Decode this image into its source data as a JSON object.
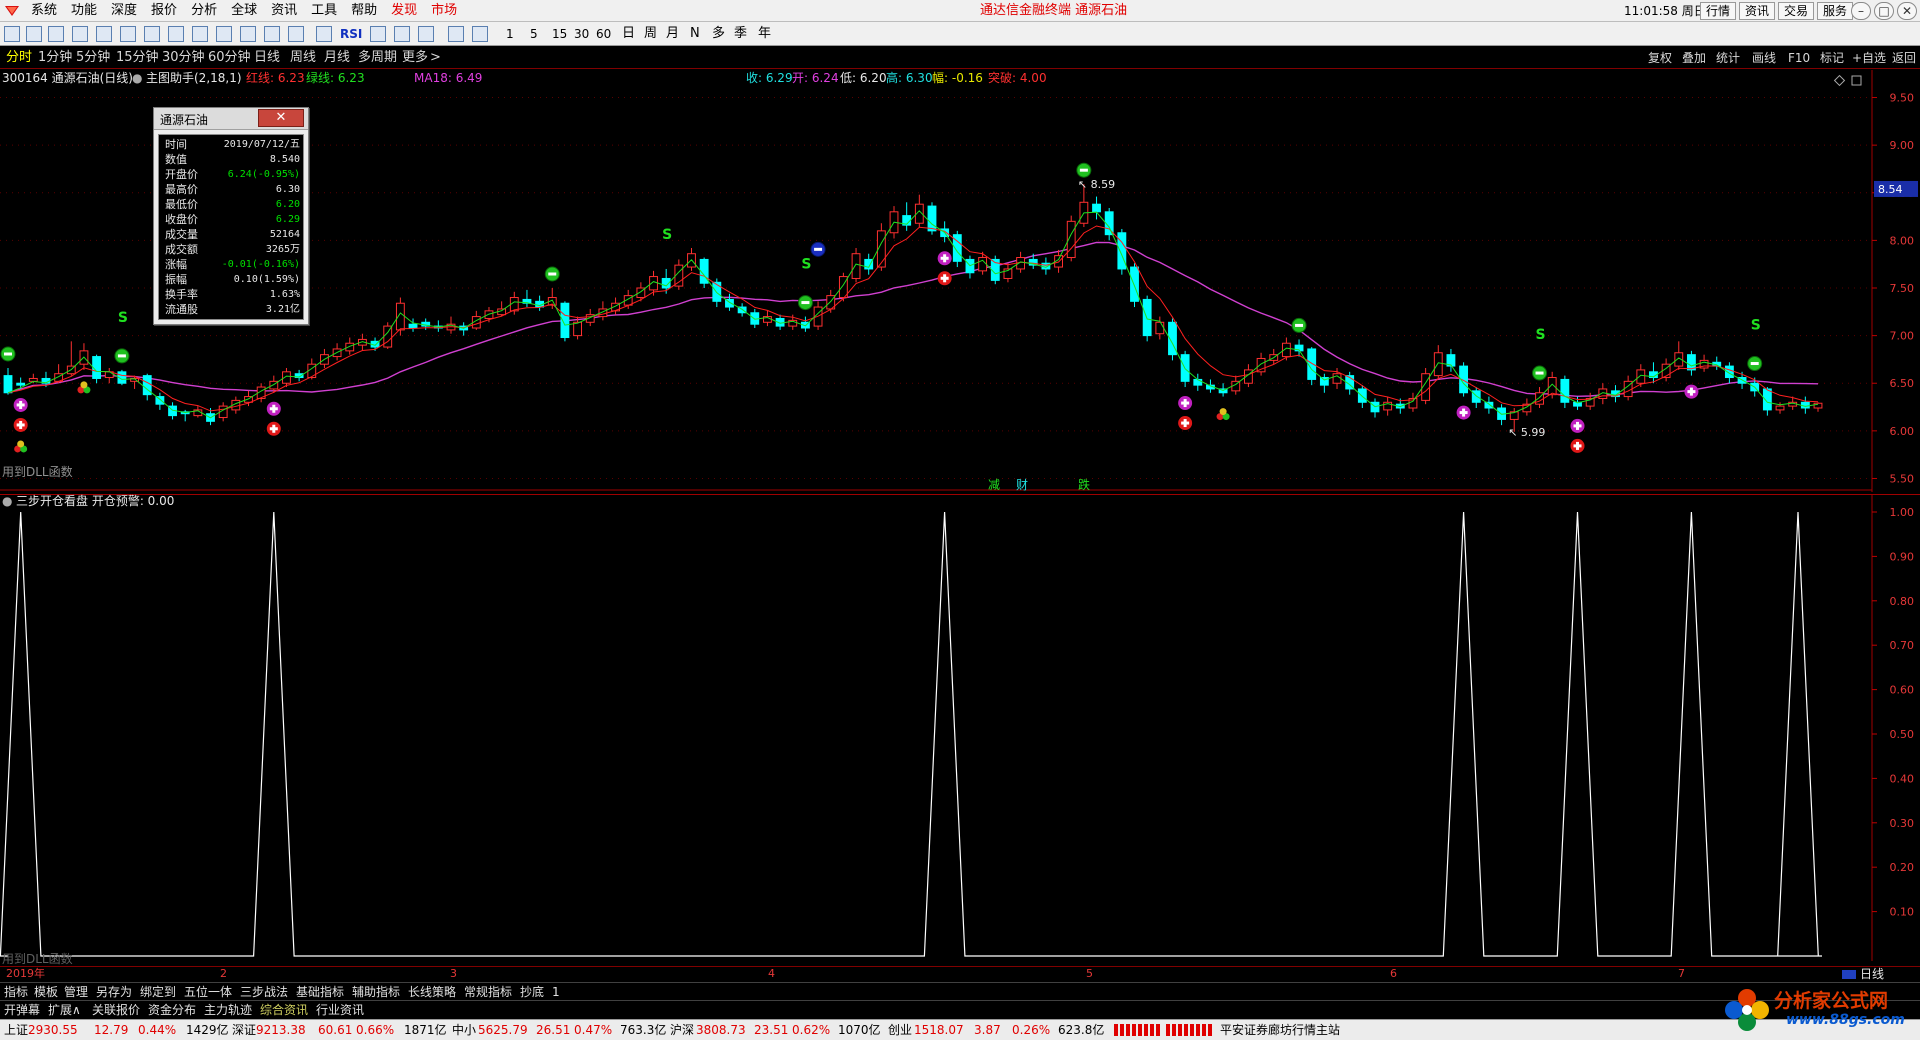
{
  "menubar": {
    "menus": [
      "系统",
      "功能",
      "深度",
      "报价",
      "分析",
      "全球",
      "资讯",
      "工具",
      "帮助"
    ],
    "hot_menus": [
      "发现",
      "市场"
    ],
    "title": "通达信金融终端 通源石油",
    "clock": "11:01:58 周日",
    "right_buttons": [
      "行情",
      "资讯",
      "交易",
      "服务"
    ]
  },
  "toolbar": {
    "rsi_label": "RSI",
    "periods": [
      "1",
      "5",
      "15",
      "30",
      "60"
    ],
    "periods_cn": [
      "日",
      "周",
      "月",
      "N",
      "多",
      "季",
      "年"
    ]
  },
  "periodbar": {
    "items": [
      "分时",
      "1分钟",
      "5分钟",
      "15分钟",
      "30分钟",
      "60分钟",
      "日线",
      "周线",
      "月线",
      "多周期",
      "更多"
    ],
    "active": "分时",
    "right_items": [
      "复权",
      "叠加",
      "统计",
      "画线",
      "F10",
      "标记",
      "+自选",
      "返回"
    ]
  },
  "mainInfo": {
    "code": "300164 通源石油(日线)",
    "assistant": "主图助手(2,18,1)",
    "red_line": "红线: 6.23",
    "green_line": "绿线: 6.23",
    "ma": "MA18: 6.49",
    "close": "收: 6.29",
    "open": "开: 6.24",
    "low": "低: 6.20",
    "high": "高: 6.30",
    "amp": "幅: -0.16",
    "breakout": "突破: 4.00",
    "dll_note": "用到DLL函数",
    "flags": [
      "减",
      "财",
      "跌"
    ]
  },
  "subInfo": {
    "title": "三步开仓看盘 开仓预警: 0.00",
    "dll_note": "用到DLL函数"
  },
  "popup": {
    "title": "通源石油",
    "close": "✕",
    "rows": [
      {
        "k": "时间",
        "v": "2019/07/12/五",
        "c": "#e8e8e8"
      },
      {
        "k": "数值",
        "v": "8.540",
        "c": "#e8e8e8"
      },
      {
        "k": "开盘价",
        "v": "6.24(-0.95%)",
        "c": "#00e000"
      },
      {
        "k": "最高价",
        "v": "6.30",
        "c": "#e8e8e8"
      },
      {
        "k": "最低价",
        "v": "6.20",
        "c": "#00e000"
      },
      {
        "k": "收盘价",
        "v": "6.29",
        "c": "#00e000"
      },
      {
        "k": "成交量",
        "v": "52164",
        "c": "#e8e8e8"
      },
      {
        "k": "成交额",
        "v": "3265万",
        "c": "#e8e8e8"
      },
      {
        "k": "涨幅",
        "v": "-0.01(-0.16%)",
        "c": "#00e000"
      },
      {
        "k": "振幅",
        "v": "0.10(1.59%)",
        "c": "#e8e8e8"
      },
      {
        "k": "换手率",
        "v": "1.63%",
        "c": "#e8e8e8"
      },
      {
        "k": "流通股",
        "v": "3.21亿",
        "c": "#e8e8e8"
      }
    ]
  },
  "timeaxis": {
    "year": "2019年",
    "months": [
      "2",
      "3",
      "4",
      "5",
      "6",
      "7"
    ],
    "right": "日线"
  },
  "tabs1": [
    "指标",
    "模板",
    "管理",
    "另存为",
    "绑定到",
    "五位一体",
    "三步战法",
    "基础指标",
    "辅助指标",
    "长线策略",
    "常规指标",
    "抄底",
    "1"
  ],
  "tabs2": [
    "开弹幕",
    "扩展∧",
    "关联报价",
    "资金分布",
    "主力轨迹",
    "综合资讯",
    "行业资讯"
  ],
  "tabs2_active": "综合资讯",
  "statusbar": {
    "items": [
      {
        "label": "上证",
        "value": "2930.55",
        "chg": "12.79",
        "pct": "0.44%",
        "amt": "1429亿"
      },
      {
        "label": "深证",
        "value": "9213.38",
        "chg": "60.61",
        "pct": "0.66%",
        "amt": "1871亿"
      },
      {
        "label": "中小",
        "value": "5625.79",
        "chg": "26.51",
        "pct": "0.47%",
        "amt": "763.3亿"
      },
      {
        "label": "沪深",
        "value": "3808.73",
        "chg": "23.51",
        "pct": "0.62%",
        "amt": "1070亿"
      },
      {
        "label": "创业",
        "value": "1518.07",
        "chg": "3.87",
        "pct": "0.26%",
        "amt": "623.8亿"
      }
    ],
    "broker": "平安证券廊坊行情主站"
  },
  "watermark": {
    "title": "分析家公式网",
    "url": "www.88gs.com"
  },
  "chart_data": {
    "type": "candlestick",
    "title": "300164 通源石油(日线)",
    "ylim": [
      5.4,
      9.6
    ],
    "y_ticks": [
      "9.50",
      "9.00",
      "8.50",
      "8.00",
      "7.50",
      "7.00",
      "6.50",
      "6.00",
      "5.50"
    ],
    "current_price_label": "8.54",
    "colors": {
      "up": "#ff3030",
      "down": "#00ffff",
      "ma18": "#d040d0",
      "red_line": "#ff2020",
      "green_line": "#20e020"
    },
    "annotations": [
      "8.59",
      "5.99"
    ],
    "candles": [
      [
        6.58,
        6.4,
        6.66,
        6.38
      ],
      [
        6.5,
        6.48,
        6.56,
        6.44
      ],
      [
        6.52,
        6.55,
        6.6,
        6.5
      ],
      [
        6.55,
        6.5,
        6.62,
        6.46
      ],
      [
        6.52,
        6.6,
        6.7,
        6.5
      ],
      [
        6.6,
        6.68,
        6.94,
        6.58
      ],
      [
        6.7,
        6.84,
        6.92,
        6.64
      ],
      [
        6.78,
        6.55,
        6.8,
        6.5
      ],
      [
        6.56,
        6.62,
        6.66,
        6.5
      ],
      [
        6.62,
        6.5,
        6.64,
        6.48
      ],
      [
        6.52,
        6.55,
        6.58,
        6.44
      ],
      [
        6.58,
        6.38,
        6.6,
        6.32
      ],
      [
        6.36,
        6.28,
        6.4,
        6.22
      ],
      [
        6.26,
        6.16,
        6.3,
        6.12
      ],
      [
        6.2,
        6.18,
        6.22,
        6.1
      ],
      [
        6.16,
        6.22,
        6.26,
        6.14
      ],
      [
        6.18,
        6.1,
        6.24,
        6.06
      ],
      [
        6.14,
        6.26,
        6.3,
        6.1
      ],
      [
        6.22,
        6.32,
        6.36,
        6.18
      ],
      [
        6.3,
        6.36,
        6.42,
        6.26
      ],
      [
        6.34,
        6.46,
        6.5,
        6.3
      ],
      [
        6.44,
        6.52,
        6.58,
        6.4
      ],
      [
        6.5,
        6.62,
        6.66,
        6.46
      ],
      [
        6.6,
        6.56,
        6.64,
        6.52
      ],
      [
        6.56,
        6.7,
        6.76,
        6.54
      ],
      [
        6.7,
        6.8,
        6.86,
        6.66
      ],
      [
        6.78,
        6.86,
        6.92,
        6.74
      ],
      [
        6.84,
        6.92,
        6.98,
        6.8
      ],
      [
        6.9,
        6.96,
        7.02,
        6.84
      ],
      [
        6.94,
        6.88,
        6.98,
        6.84
      ],
      [
        6.88,
        7.1,
        7.14,
        6.86
      ],
      [
        7.06,
        7.34,
        7.4,
        7.0
      ],
      [
        7.12,
        7.08,
        7.18,
        7.04
      ],
      [
        7.14,
        7.1,
        7.18,
        7.06
      ],
      [
        7.1,
        7.08,
        7.16,
        7.04
      ],
      [
        7.06,
        7.12,
        7.2,
        7.02
      ],
      [
        7.1,
        7.06,
        7.14,
        7.0
      ],
      [
        7.08,
        7.2,
        7.26,
        7.06
      ],
      [
        7.18,
        7.26,
        7.3,
        7.14
      ],
      [
        7.22,
        7.28,
        7.36,
        7.2
      ],
      [
        7.26,
        7.4,
        7.46,
        7.22
      ],
      [
        7.38,
        7.34,
        7.48,
        7.3
      ],
      [
        7.36,
        7.3,
        7.42,
        7.26
      ],
      [
        7.32,
        7.4,
        7.5,
        7.28
      ],
      [
        7.34,
        6.98,
        7.36,
        6.94
      ],
      [
        7.0,
        7.14,
        7.2,
        6.96
      ],
      [
        7.14,
        7.22,
        7.28,
        7.1
      ],
      [
        7.2,
        7.28,
        7.36,
        7.16
      ],
      [
        7.26,
        7.34,
        7.4,
        7.22
      ],
      [
        7.32,
        7.42,
        7.48,
        7.28
      ],
      [
        7.4,
        7.5,
        7.56,
        7.36
      ],
      [
        7.48,
        7.62,
        7.68,
        7.42
      ],
      [
        7.6,
        7.5,
        7.7,
        7.44
      ],
      [
        7.52,
        7.74,
        7.8,
        7.48
      ],
      [
        7.72,
        7.86,
        7.92,
        7.68
      ],
      [
        7.8,
        7.55,
        7.82,
        7.5
      ],
      [
        7.56,
        7.36,
        7.6,
        7.3
      ],
      [
        7.38,
        7.3,
        7.44,
        7.26
      ],
      [
        7.3,
        7.24,
        7.34,
        7.2
      ],
      [
        7.24,
        7.12,
        7.28,
        7.08
      ],
      [
        7.14,
        7.2,
        7.26,
        7.1
      ],
      [
        7.18,
        7.1,
        7.22,
        7.06
      ],
      [
        7.1,
        7.16,
        7.22,
        7.06
      ],
      [
        7.14,
        7.08,
        7.2,
        7.04
      ],
      [
        7.1,
        7.3,
        7.36,
        7.06
      ],
      [
        7.28,
        7.42,
        7.48,
        7.24
      ],
      [
        7.4,
        7.62,
        7.66,
        7.36
      ],
      [
        7.6,
        7.86,
        7.92,
        7.56
      ],
      [
        7.8,
        7.7,
        7.86,
        7.64
      ],
      [
        7.72,
        8.1,
        8.18,
        7.68
      ],
      [
        8.08,
        8.3,
        8.36,
        8.02
      ],
      [
        8.26,
        8.16,
        8.4,
        8.1
      ],
      [
        8.18,
        8.38,
        8.48,
        8.14
      ],
      [
        8.36,
        8.1,
        8.4,
        8.06
      ],
      [
        8.12,
        8.04,
        8.2,
        7.98
      ],
      [
        8.06,
        7.78,
        8.1,
        7.72
      ],
      [
        7.8,
        7.66,
        7.84,
        7.6
      ],
      [
        7.68,
        7.82,
        7.88,
        7.64
      ],
      [
        7.8,
        7.58,
        7.84,
        7.54
      ],
      [
        7.6,
        7.7,
        7.76,
        7.56
      ],
      [
        7.7,
        7.82,
        7.88,
        7.66
      ],
      [
        7.8,
        7.74,
        7.86,
        7.7
      ],
      [
        7.76,
        7.7,
        7.82,
        7.64
      ],
      [
        7.72,
        7.84,
        7.9,
        7.66
      ],
      [
        7.82,
        8.2,
        8.26,
        7.78
      ],
      [
        8.18,
        8.4,
        8.59,
        8.14
      ],
      [
        8.38,
        8.3,
        8.46,
        8.22
      ],
      [
        8.3,
        8.06,
        8.34,
        8.0
      ],
      [
        8.08,
        7.7,
        8.12,
        7.64
      ],
      [
        7.72,
        7.36,
        7.76,
        7.3
      ],
      [
        7.38,
        7.0,
        7.42,
        6.94
      ],
      [
        7.02,
        7.14,
        7.2,
        6.96
      ],
      [
        7.14,
        6.8,
        7.18,
        6.74
      ],
      [
        6.8,
        6.52,
        6.84,
        6.46
      ],
      [
        6.54,
        6.48,
        6.6,
        6.42
      ],
      [
        6.48,
        6.44,
        6.54,
        6.4
      ],
      [
        6.44,
        6.4,
        6.5,
        6.36
      ],
      [
        6.42,
        6.52,
        6.58,
        6.38
      ],
      [
        6.5,
        6.64,
        6.7,
        6.46
      ],
      [
        6.62,
        6.76,
        6.82,
        6.58
      ],
      [
        6.74,
        6.8,
        6.86,
        6.7
      ],
      [
        6.78,
        6.92,
        6.98,
        6.74
      ],
      [
        6.9,
        6.84,
        6.96,
        6.78
      ],
      [
        6.86,
        6.54,
        6.88,
        6.48
      ],
      [
        6.56,
        6.48,
        6.6,
        6.4
      ],
      [
        6.5,
        6.6,
        6.66,
        6.44
      ],
      [
        6.58,
        6.44,
        6.62,
        6.38
      ],
      [
        6.44,
        6.3,
        6.48,
        6.24
      ],
      [
        6.3,
        6.2,
        6.34,
        6.14
      ],
      [
        6.22,
        6.3,
        6.36,
        6.16
      ],
      [
        6.28,
        6.24,
        6.34,
        6.18
      ],
      [
        6.24,
        6.34,
        6.4,
        6.2
      ],
      [
        6.32,
        6.6,
        6.66,
        6.28
      ],
      [
        6.58,
        6.82,
        6.9,
        6.54
      ],
      [
        6.8,
        6.68,
        6.86,
        6.62
      ],
      [
        6.68,
        6.4,
        6.72,
        6.36
      ],
      [
        6.42,
        6.3,
        6.46,
        6.24
      ],
      [
        6.3,
        6.24,
        6.36,
        6.18
      ],
      [
        6.24,
        6.12,
        6.28,
        6.06
      ],
      [
        6.12,
        6.2,
        6.24,
        5.99
      ],
      [
        6.2,
        6.28,
        6.34,
        6.16
      ],
      [
        6.28,
        6.4,
        6.46,
        6.24
      ],
      [
        6.38,
        6.56,
        6.62,
        6.34
      ],
      [
        6.54,
        6.3,
        6.58,
        6.24
      ],
      [
        6.3,
        6.26,
        6.36,
        6.22
      ],
      [
        6.26,
        6.34,
        6.4,
        6.22
      ],
      [
        6.34,
        6.44,
        6.5,
        6.28
      ],
      [
        6.42,
        6.36,
        6.48,
        6.3
      ],
      [
        6.36,
        6.52,
        6.58,
        6.32
      ],
      [
        6.5,
        6.64,
        6.7,
        6.46
      ],
      [
        6.62,
        6.56,
        6.72,
        6.5
      ],
      [
        6.56,
        6.7,
        6.76,
        6.52
      ],
      [
        6.68,
        6.82,
        6.94,
        6.64
      ],
      [
        6.8,
        6.64,
        6.84,
        6.58
      ],
      [
        6.66,
        6.74,
        6.8,
        6.62
      ],
      [
        6.72,
        6.68,
        6.78,
        6.64
      ],
      [
        6.68,
        6.56,
        6.72,
        6.5
      ],
      [
        6.56,
        6.5,
        6.62,
        6.44
      ],
      [
        6.5,
        6.42,
        6.56,
        6.36
      ],
      [
        6.44,
        6.22,
        6.46,
        6.16
      ],
      [
        6.22,
        6.26,
        6.3,
        6.18
      ],
      [
        6.26,
        6.3,
        6.36,
        6.22
      ],
      [
        6.3,
        6.24,
        6.36,
        6.18
      ],
      [
        6.24,
        6.29,
        6.3,
        6.2
      ]
    ],
    "signals": [
      {
        "i": 0,
        "kind": "sell_circle"
      },
      {
        "i": 1,
        "kind": "buy_plus_purple"
      },
      {
        "i": 1,
        "kind": "buy_plus_red"
      },
      {
        "i": 1,
        "kind": "clover"
      },
      {
        "i": 6,
        "kind": "clover"
      },
      {
        "i": 9,
        "kind": "sell_circle"
      },
      {
        "i": 9,
        "kind": "S"
      },
      {
        "i": 21,
        "kind": "buy_plus_purple"
      },
      {
        "i": 21,
        "kind": "buy_plus_red"
      },
      {
        "i": 43,
        "kind": "sell_circle"
      },
      {
        "i": 52,
        "kind": "S"
      },
      {
        "i": 63,
        "kind": "sell_circle"
      },
      {
        "i": 63,
        "kind": "S"
      },
      {
        "i": 64,
        "kind": "blue_minus"
      },
      {
        "i": 74,
        "kind": "buy_plus_purple"
      },
      {
        "i": 74,
        "kind": "buy_plus_red"
      },
      {
        "i": 85,
        "kind": "sell_circle"
      },
      {
        "i": 93,
        "kind": "buy_plus_purple"
      },
      {
        "i": 93,
        "kind": "buy_plus_red"
      },
      {
        "i": 96,
        "kind": "clover"
      },
      {
        "i": 102,
        "kind": "sell_circle"
      },
      {
        "i": 115,
        "kind": "buy_plus_purple"
      },
      {
        "i": 121,
        "kind": "sell_circle"
      },
      {
        "i": 121,
        "kind": "S"
      },
      {
        "i": 124,
        "kind": "buy_plus_purple"
      },
      {
        "i": 124,
        "kind": "buy_plus_red"
      },
      {
        "i": 133,
        "kind": "buy_plus_purple"
      },
      {
        "i": 138,
        "kind": "sell_circle"
      },
      {
        "i": 138,
        "kind": "S"
      },
      {
        "i": 146,
        "kind": "buy_plus_purple"
      },
      {
        "i": 146,
        "kind": "buy_plus_red"
      },
      {
        "i": 150,
        "kind": "sell_circle"
      },
      {
        "i": 150,
        "kind": "S"
      },
      {
        "i": 165,
        "kind": "sell_circle"
      },
      {
        "i": 166,
        "kind": "clover"
      }
    ],
    "sub": {
      "title": "三步开仓看盘 开仓预警: 0.00",
      "ylim": [
        0,
        1
      ],
      "y_ticks": [
        "1.00",
        "0.90",
        "0.80",
        "0.70",
        "0.60",
        "0.50",
        "0.40",
        "0.30",
        "0.20",
        "0.10"
      ],
      "spikes_at": [
        1,
        21,
        74,
        115,
        124,
        133,
        146,
        180
      ]
    }
  }
}
